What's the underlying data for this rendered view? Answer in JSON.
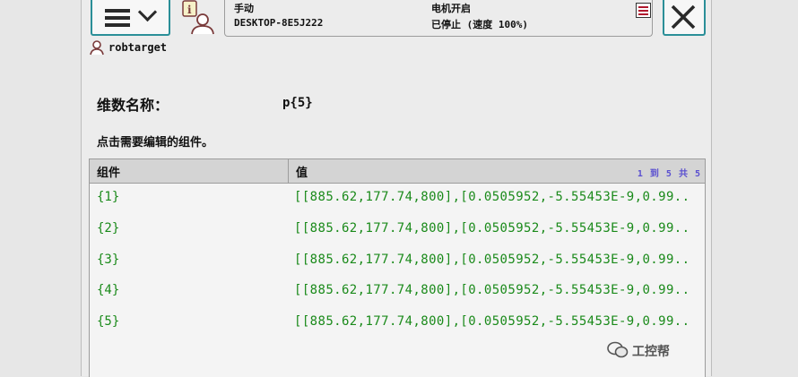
{
  "header": {
    "mode": "手动",
    "controller": "DESKTOP-8E5J222",
    "motor_status": "电机开启",
    "run_status": "已停止 (速度 100%)"
  },
  "breadcrumb": {
    "label": "robtarget"
  },
  "dimension": {
    "label": "维数名称：",
    "value": "p{5}"
  },
  "instruction": "点击需要编辑的组件。",
  "table": {
    "columns": [
      "组件",
      "值"
    ],
    "pager": "1 到 5 共 5",
    "rows": [
      {
        "component": "{1}",
        "value": "[[885.62,177.74,800],[0.0505952,-5.55453E-9,0.99.."
      },
      {
        "component": "{2}",
        "value": "[[885.62,177.74,800],[0.0505952,-5.55453E-9,0.99.."
      },
      {
        "component": "{3}",
        "value": "[[885.62,177.74,800],[0.0505952,-5.55453E-9,0.99.."
      },
      {
        "component": "{4}",
        "value": "[[885.62,177.74,800],[0.0505952,-5.55453E-9,0.99.."
      },
      {
        "component": "{5}",
        "value": "[[885.62,177.74,800],[0.0505952,-5.55453E-9,0.99.."
      }
    ]
  },
  "watermark": "工控帮",
  "icons": {
    "menu": "hamburger-chevron-icon",
    "info": "operator-info-icon",
    "status": "event-log-icon",
    "close": "close-icon",
    "breadcrumb": "person-icon",
    "watermark": "wechat-icon"
  },
  "colors": {
    "accent": "#2b8f98",
    "value_text": "#1a8a1a",
    "pager_text": "#5a4fd0",
    "header_bg": "#d4d4d4"
  }
}
